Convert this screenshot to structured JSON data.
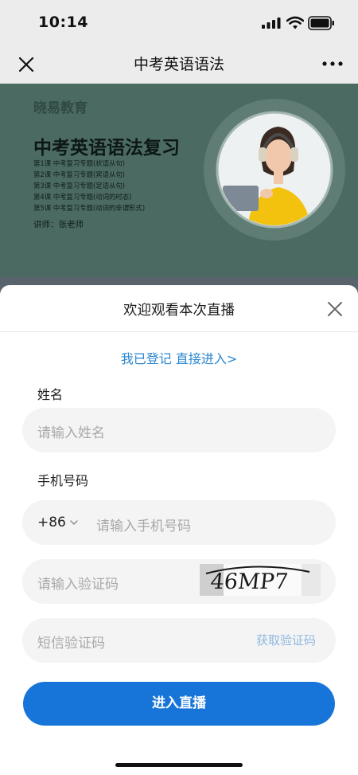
{
  "status_bar": {
    "time": "10:14"
  },
  "nav": {
    "title": "中考英语语法",
    "close_icon": "close-icon",
    "more_icon": "more-icon"
  },
  "banner": {
    "brand": "晓易教育",
    "title": "中考英语语法复习",
    "lessons": [
      "第1课 中考复习专题(状语从句)",
      "第2课 中考复习专题(宾语从句)",
      "第3课 中考复习专题(定语从句)",
      "第4课 中考复习专题(动词的时态)",
      "第5课 中考复习专题(动词的非谓形式)"
    ],
    "teacher": "讲师：张老师"
  },
  "sheet": {
    "title": "欢迎观看本次直播",
    "registered_link": "我已登记 直接进入>",
    "name_label": "姓名",
    "name_placeholder": "请输入姓名",
    "phone_label": "手机号码",
    "country_code": "+86",
    "phone_placeholder": "请输入手机号码",
    "captcha_placeholder": "请输入验证码",
    "captcha_text": "46MP7",
    "sms_placeholder": "短信验证码",
    "get_code": "获取验证码",
    "submit": "进入直播"
  },
  "colors": {
    "accent": "#1775d9",
    "link": "#2a86cf",
    "banner_bg": "#4b6a62"
  }
}
